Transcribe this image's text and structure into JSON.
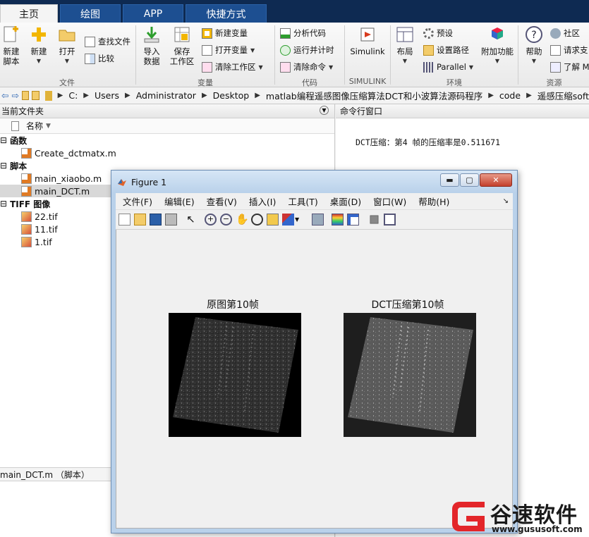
{
  "tabs": [
    {
      "label": "主页"
    },
    {
      "label": "绘图"
    },
    {
      "label": "APP"
    },
    {
      "label": "快捷方式"
    }
  ],
  "ribbon": {
    "file_group": {
      "label": "文件",
      "new_script": "新建\n脚本",
      "new": "新建",
      "open": "打开",
      "find_files": "查找文件",
      "compare": "比较"
    },
    "variable_group": {
      "label": "变量",
      "import_data": "导入\n数据",
      "save_workspace": "保存\n工作区",
      "new_variable": "新建变量",
      "open_variable": "打开变量",
      "clear_workspace": "清除工作区"
    },
    "code_group": {
      "label": "代码",
      "analyze_code": "分析代码",
      "run_and_time": "运行并计时",
      "clear_commands": "清除命令"
    },
    "simulink_group": {
      "label": "SIMULINK",
      "simulink": "Simulink"
    },
    "environment_group": {
      "label": "环境",
      "layout": "布局",
      "preferences": "预设",
      "set_path": "设置路径",
      "parallel": "Parallel",
      "addons": "附加功能"
    },
    "resources_group": {
      "label": "资源",
      "help": "帮助",
      "community": "社区",
      "request_support": "请求支",
      "learn": "了解 M"
    }
  },
  "address": {
    "path": [
      "C:",
      "Users",
      "Administrator",
      "Desktop",
      "matlab编程遥感图像压缩算法DCT和小波算法源码程序",
      "code",
      "遥感压缩soft"
    ]
  },
  "left_pane": {
    "title": "当前文件夹",
    "column_name": "名称",
    "groups": [
      {
        "label": "函数",
        "files": [
          {
            "name": "Create_dctmatx.m",
            "type": "m"
          }
        ]
      },
      {
        "label": "脚本",
        "files": [
          {
            "name": "main_xiaobo.m",
            "type": "m"
          },
          {
            "name": "main_DCT.m",
            "type": "m",
            "selected": true
          }
        ]
      },
      {
        "label": "TIFF 图像",
        "files": [
          {
            "name": "22.tif",
            "type": "tif"
          },
          {
            "name": "11.tif",
            "type": "tif"
          },
          {
            "name": "1.tif",
            "type": "tif"
          }
        ]
      }
    ],
    "details": "main_DCT.m （脚本）"
  },
  "command_window": {
    "title": "命令行窗口",
    "output": "DCT压缩：第4 帧的压缩率是0.511671"
  },
  "figure": {
    "title": "Figure 1",
    "menus": [
      "文件(F)",
      "编辑(E)",
      "查看(V)",
      "插入(I)",
      "工具(T)",
      "桌面(D)",
      "窗口(W)",
      "帮助(H)"
    ],
    "axes": [
      {
        "title": "原图第10帧"
      },
      {
        "title": "DCT压缩第10帧"
      }
    ]
  },
  "watermark": {
    "brand": "谷速软件",
    "url": "www.gususoft.com"
  },
  "colors": {
    "tabbar": "#0e2a52",
    "tab": "#1d4f91",
    "watermark_red": "#e3262a"
  }
}
